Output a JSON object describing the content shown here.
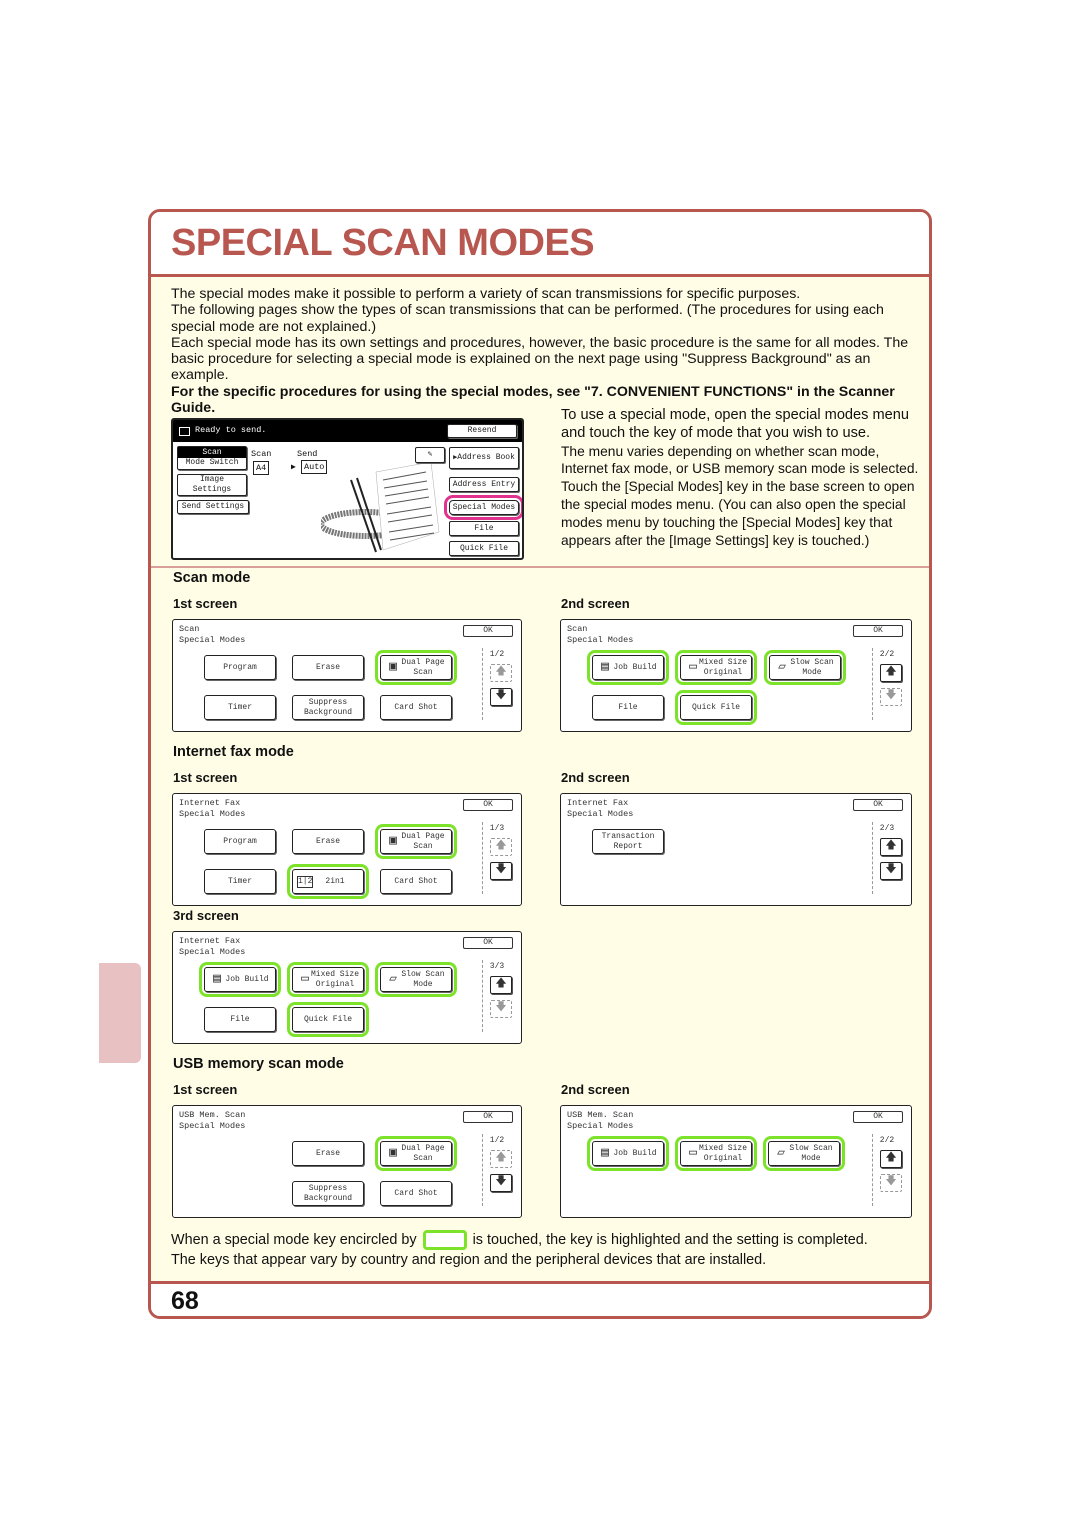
{
  "page": {
    "title": "SPECIAL SCAN MODES",
    "page_number": "68",
    "accent_color": "#b8574f",
    "highlight_color": "#7de32a",
    "selection_color": "#e0338f"
  },
  "intro": {
    "p1": "The special modes make it possible to perform a variety of scan transmissions for specific purposes.",
    "p2": "The following pages show the types of scan transmissions that can be performed. (The procedures for using each special mode are not explained.)",
    "p3": "Each special mode has its own settings and procedures, however, the basic procedure is the same for all modes. The basic procedure for selecting a special mode is explained on the next page using \"Suppress Background\" as an example.",
    "p4_bold": "For the specific procedures for using the special modes, see \"7. CONVENIENT FUNCTIONS\" in the Scanner Guide."
  },
  "side_text": {
    "line1": "To use a special mode, open the special modes menu and touch the key of mode that you wish to use.",
    "line2": "The menu varies depending on whether scan mode, Internet fax mode, or USB memory scan mode is selected. Touch the [Special Modes] key in the base screen to open the special modes menu. (You can also open the special modes menu by touching the [Special Modes] key that appears after the [Image Settings] key is touched.)"
  },
  "base_screen": {
    "status": "Ready to send.",
    "resend": "Resend",
    "mode_scan": "Scan",
    "mode_switch": "Mode Switch",
    "image_settings": "Image Settings",
    "send_settings": "Send Settings",
    "scan_label": "Scan",
    "send_label": "Send",
    "scan_size": "A4",
    "send_size": "Auto",
    "address_book": "Address Book",
    "address_entry": "Address Entry",
    "special_modes": "Special Modes",
    "file": "File",
    "quick_file": "Quick File"
  },
  "sections": {
    "scan": {
      "heading": "Scan mode",
      "screen1_label": "1st screen",
      "screen2_label": "2nd screen",
      "screen1": {
        "title1": "Scan",
        "title2": "Special Modes",
        "ok": "OK",
        "page": "1/2",
        "keys": [
          "Program",
          "Erase",
          "Dual Page Scan",
          "Timer",
          "Suppress Background",
          "Card Shot"
        ]
      },
      "screen2": {
        "title1": "Scan",
        "title2": "Special Modes",
        "ok": "OK",
        "page": "2/2",
        "keys": [
          "Job Build",
          "Mixed Size Original",
          "Slow Scan Mode",
          "File",
          "Quick File"
        ]
      }
    },
    "ifax": {
      "heading": "Internet fax mode",
      "screen1_label": "1st screen",
      "screen2_label": "2nd screen",
      "screen3_label": "3rd screen",
      "screen1": {
        "title1": "Internet Fax",
        "title2": "Special Modes",
        "ok": "OK",
        "page": "1/3",
        "keys": [
          "Program",
          "Erase",
          "Dual Page Scan",
          "Timer",
          "2in1",
          "Card Shot"
        ]
      },
      "screen2": {
        "title1": "Internet Fax",
        "title2": "Special Modes",
        "ok": "OK",
        "page": "2/3",
        "keys": [
          "Transaction Report"
        ]
      },
      "screen3": {
        "title1": "Internet Fax",
        "title2": "Special Modes",
        "ok": "OK",
        "page": "3/3",
        "keys": [
          "Job Build",
          "Mixed Size Original",
          "Slow Scan Mode",
          "File",
          "Quick File"
        ]
      }
    },
    "usb": {
      "heading": "USB memory scan mode",
      "screen1_label": "1st screen",
      "screen2_label": "2nd screen",
      "screen1": {
        "title1": "USB Mem. Scan",
        "title2": "Special Modes",
        "ok": "OK",
        "page": "1/2",
        "keys": [
          "Erase",
          "Dual Page Scan",
          "Suppress Background",
          "Card Shot"
        ]
      },
      "screen2": {
        "title1": "USB Mem. Scan",
        "title2": "Special Modes",
        "ok": "OK",
        "page": "2/2",
        "keys": [
          "Job Build",
          "Mixed Size Original",
          "Slow Scan Mode"
        ]
      }
    }
  },
  "note": {
    "before": "When a special mode key encircled by",
    "after": "is touched, the key is highlighted and the setting is completed.",
    "line2": "The keys that appear vary by country and region and the peripheral devices that are installed."
  },
  "icons": {
    "up": "🡅",
    "down": "🡇",
    "arrow_right": "▶"
  }
}
